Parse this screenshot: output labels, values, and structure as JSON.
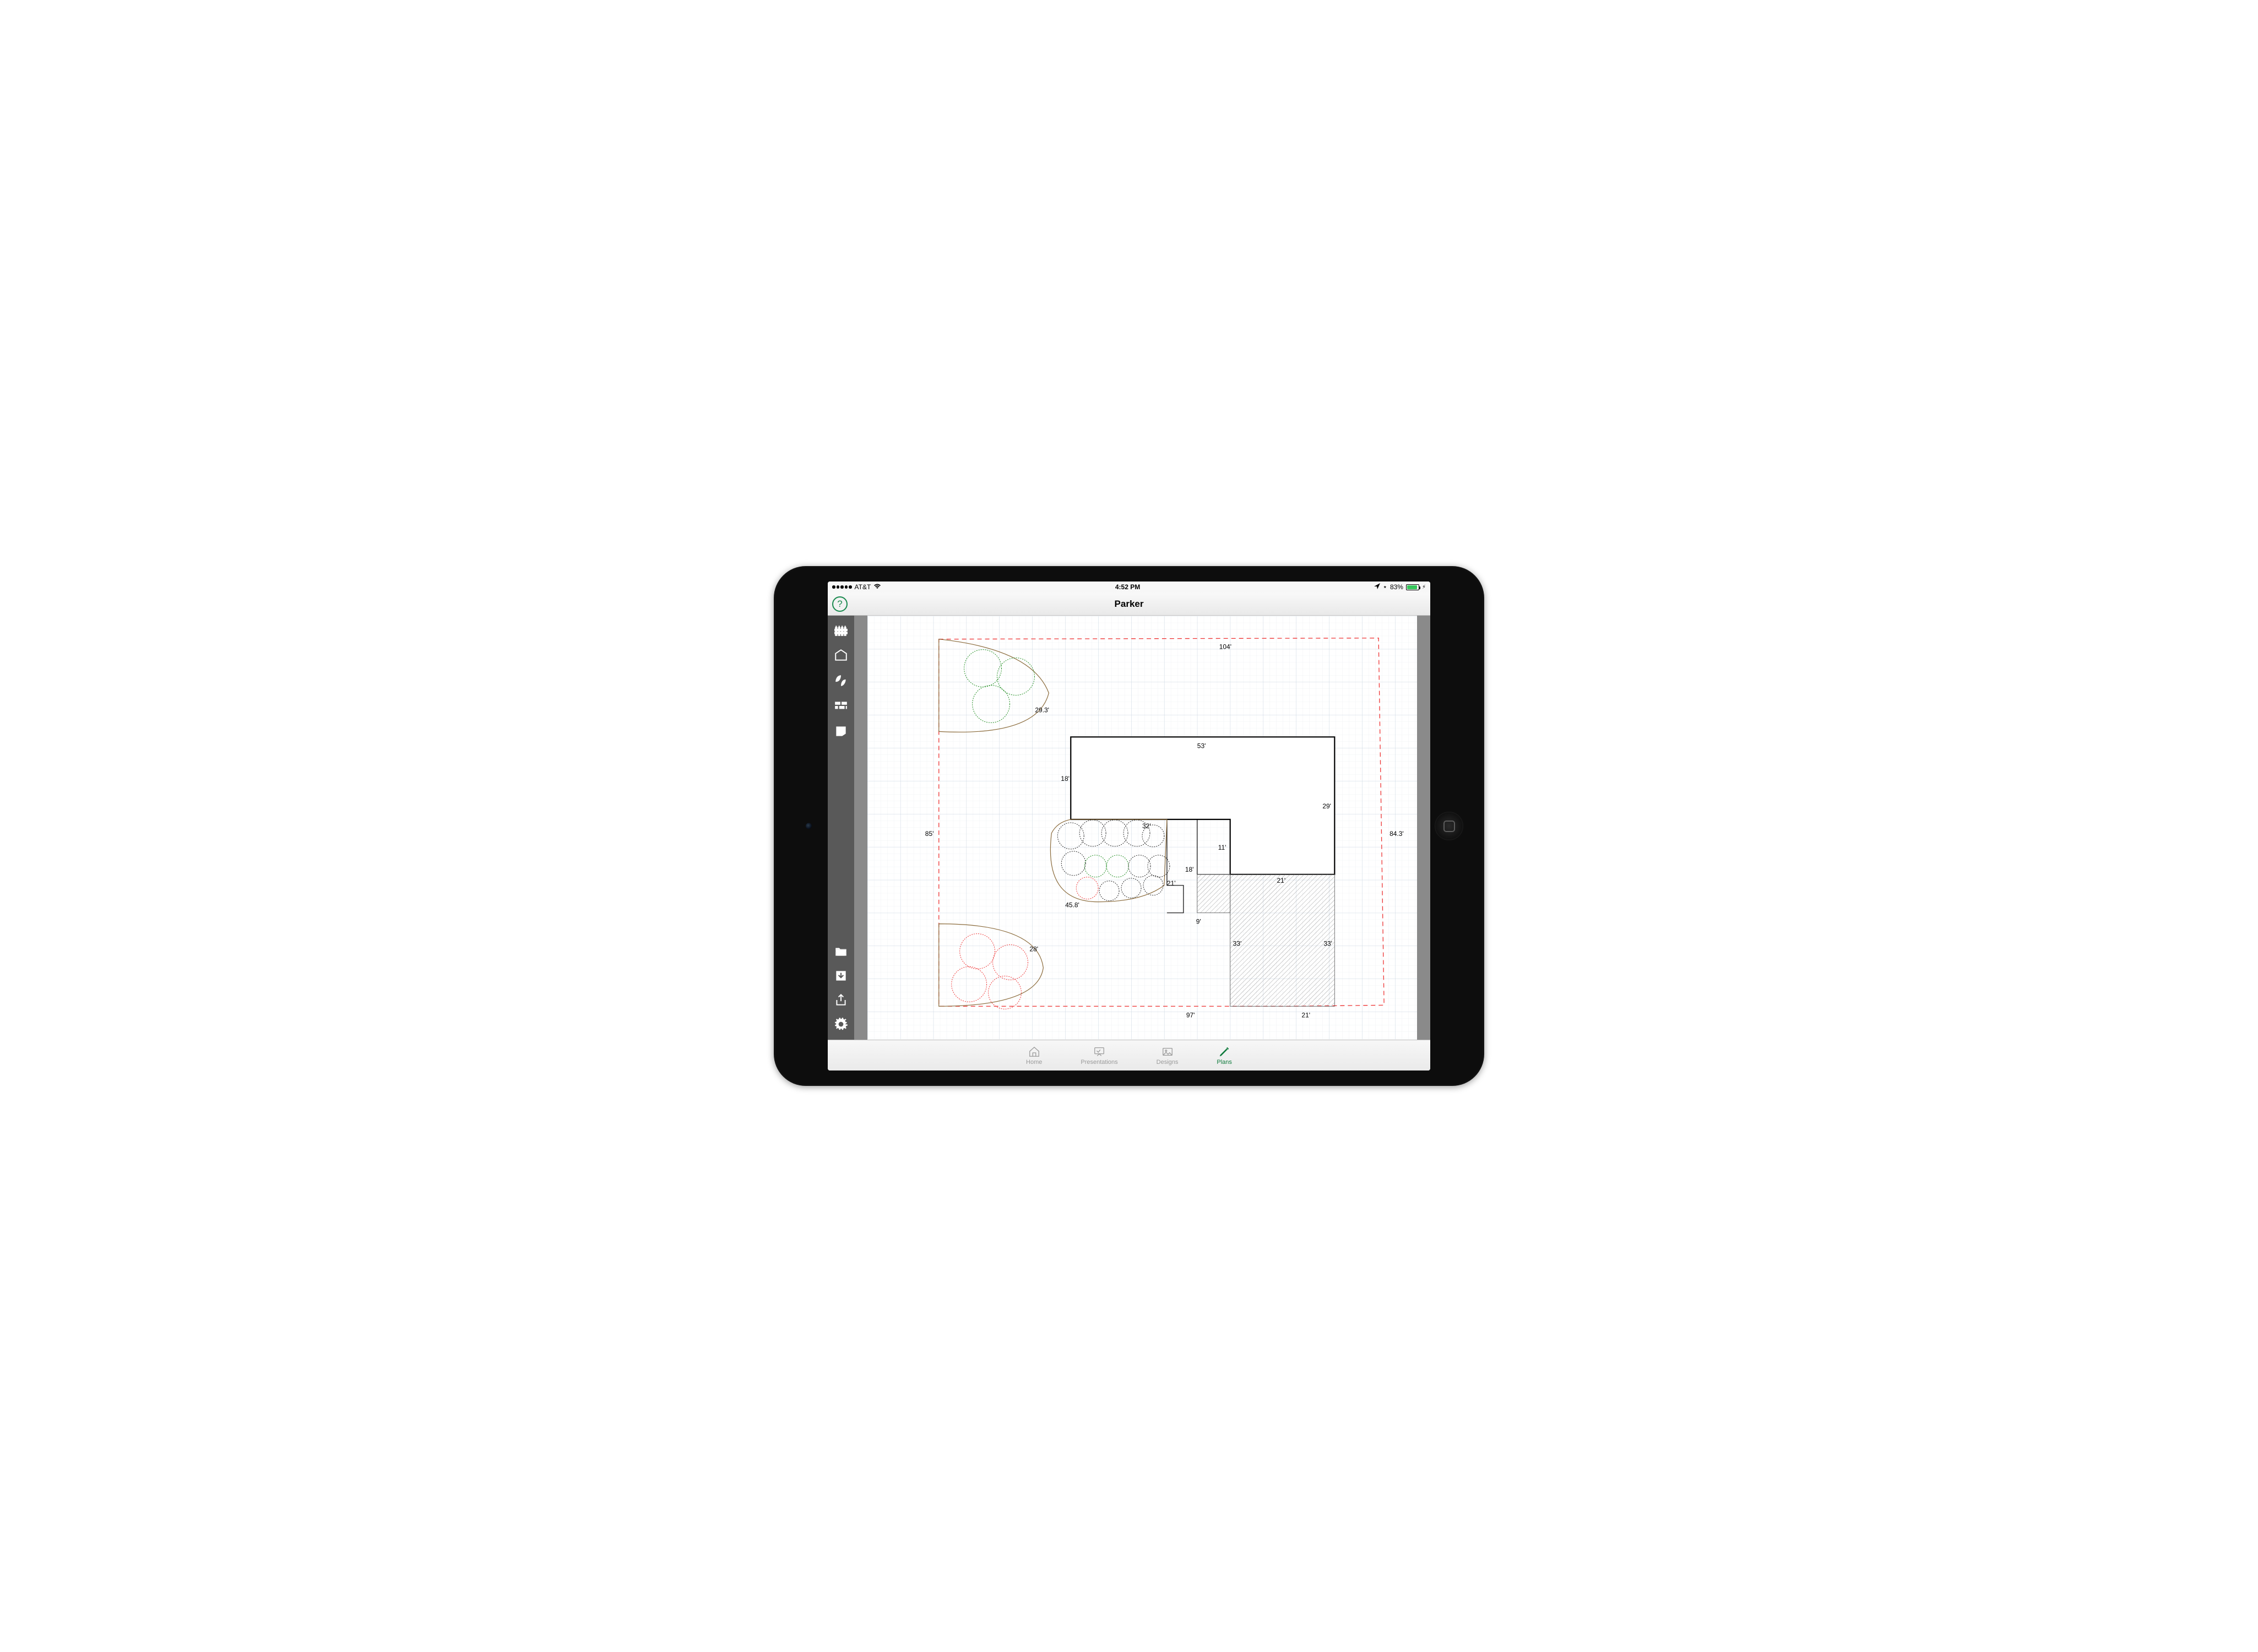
{
  "status": {
    "carrier": "AT&T",
    "time": "4:52 PM",
    "battery_pct": "83%"
  },
  "header": {
    "title": "Parker",
    "help_label": "?"
  },
  "sidebar": {
    "tools": [
      {
        "id": "fence",
        "name": "fence-tool"
      },
      {
        "id": "structure",
        "name": "structure-tool"
      },
      {
        "id": "plant",
        "name": "plant-tool"
      },
      {
        "id": "hardscape",
        "name": "hardscape-tool"
      },
      {
        "id": "area",
        "name": "area-tool"
      }
    ],
    "actions": [
      {
        "id": "folder",
        "name": "open-folder-button"
      },
      {
        "id": "download",
        "name": "import-button"
      },
      {
        "id": "share",
        "name": "share-button"
      },
      {
        "id": "settings",
        "name": "settings-button"
      }
    ]
  },
  "plan": {
    "boundary_dims": {
      "top": "104'",
      "right": "84.3'",
      "left": "85'",
      "bottom_a": "97'",
      "bottom_b": "21'"
    },
    "house_dims": {
      "top": "53'",
      "right": "29'",
      "left": "18'",
      "step_w": "32'",
      "step_h": "11'",
      "inner_h": "18'",
      "inner_w": "9'",
      "patio_w": "21'",
      "patio_h_a": "33'",
      "patio_h_b": "33'"
    },
    "beds": {
      "nw": "29.3'",
      "front": "45.8'",
      "sw": "28'",
      "front_label": "21'"
    }
  },
  "tabs": {
    "home": "Home",
    "presentations": "Presentations",
    "designs": "Designs",
    "plans": "Plans",
    "active": "plans"
  }
}
